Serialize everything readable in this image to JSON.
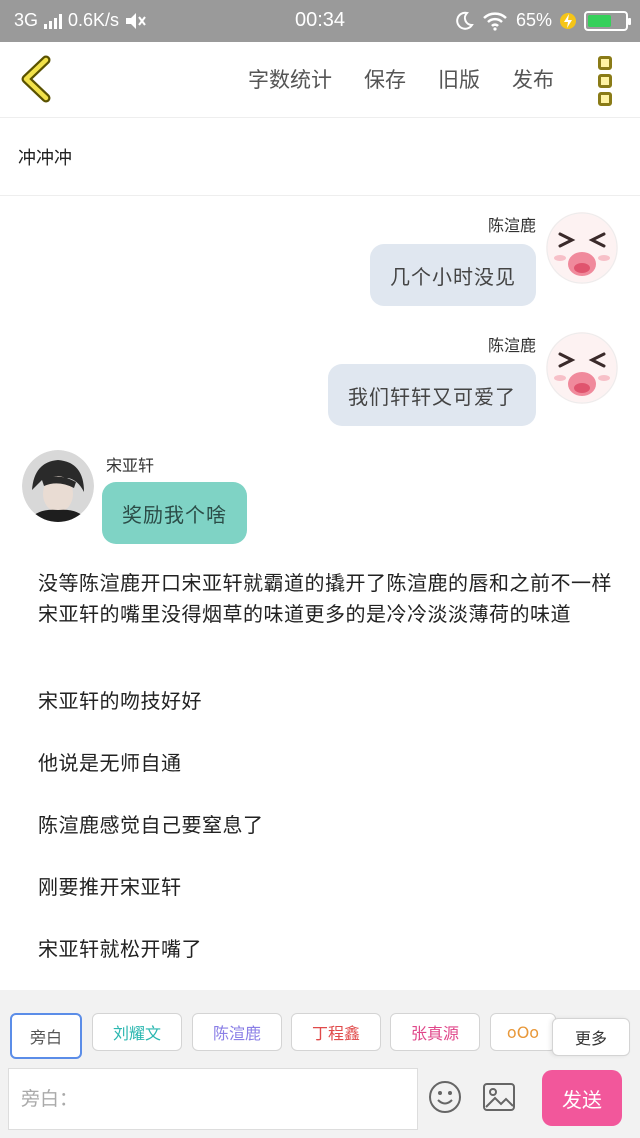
{
  "status_bar": {
    "network": "3G",
    "speed": "0.6K/s",
    "time": "00:34",
    "battery": "65%",
    "battery_level": 0.65
  },
  "toolbar": {
    "word_count": "字数统计",
    "save": "保存",
    "old_version": "旧版",
    "publish": "发布"
  },
  "document": {
    "title": "冲冲冲"
  },
  "messages": [
    {
      "speaker": "陈渲鹿",
      "text": "几个小时没见",
      "side": "right"
    },
    {
      "speaker": "陈渲鹿",
      "text": "我们轩轩又可爱了",
      "side": "right"
    },
    {
      "speaker": "宋亚轩",
      "text": "奖励我个啥",
      "side": "left"
    }
  ],
  "narration": [
    "没等陈渲鹿开口宋亚轩就霸道的撬开了陈渲鹿的唇和之前不一样 宋亚轩的嘴里没得烟草的味道更多的是冷冷淡淡薄荷的味道",
    "宋亚轩的吻技好好",
    "他说是无师自通",
    "陈渲鹿感觉自己要窒息了",
    "刚要推开宋亚轩",
    "宋亚轩就松开嘴了"
  ],
  "roles": [
    {
      "label": "旁白",
      "color": "#555555",
      "active": true
    },
    {
      "label": "刘耀文",
      "color": "#2bb7b0"
    },
    {
      "label": "陈渲鹿",
      "color": "#8a7fe6"
    },
    {
      "label": "丁程鑫",
      "color": "#e04a4a"
    },
    {
      "label": "张真源",
      "color": "#e0478a"
    },
    {
      "label": "oOo",
      "color": "#e8983a"
    },
    {
      "label": "更多",
      "color": "#333333"
    }
  ],
  "composer": {
    "placeholder": "旁白：",
    "send": "发送"
  },
  "colors": {
    "right_bubble": "#e0e7f0",
    "left_bubble": "#7fd3c5",
    "send_button": "#f2579b",
    "menu_icon": "#fff3a3"
  }
}
